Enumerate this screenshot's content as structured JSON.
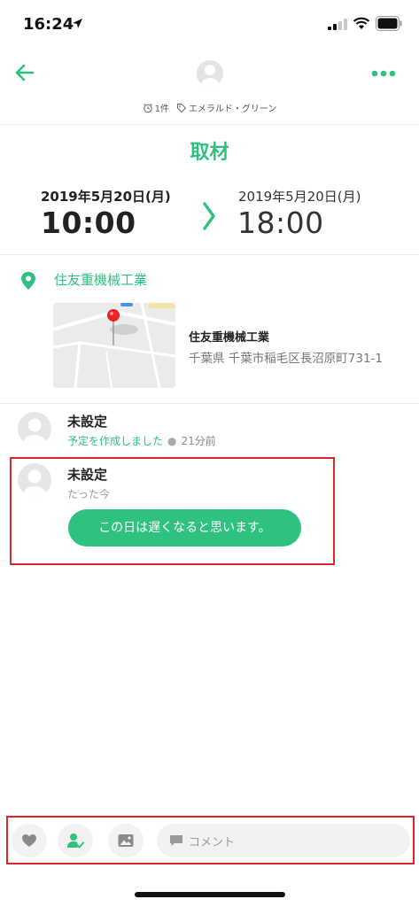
{
  "status_bar": {
    "time": "16:24"
  },
  "header": {
    "meta_count": "1件",
    "meta_tag": "エメラルド・グリーン",
    "accent": "#2ec27e"
  },
  "event": {
    "title": "取材",
    "start_date": "2019年5月20日(月)",
    "start_time": "10:00",
    "end_date": "2019年5月20日(月)",
    "end_time": "18:00"
  },
  "location": {
    "name": "住友重機械工業",
    "place_name": "住友重機械工業",
    "address": "千葉県 千葉市稲毛区長沼原町731-1"
  },
  "activity": [
    {
      "name": "未設定",
      "action": "予定を作成しました",
      "time": "21分前"
    },
    {
      "name": "未設定",
      "time": "たった今",
      "message": "この日は遅くなると思います。"
    }
  ],
  "bottom_bar": {
    "comment_placeholder": "コメント",
    "icons": [
      "heart-icon",
      "attend-person-icon",
      "image-icon",
      "comment-icon"
    ]
  },
  "highlight_color": "#e0242b"
}
